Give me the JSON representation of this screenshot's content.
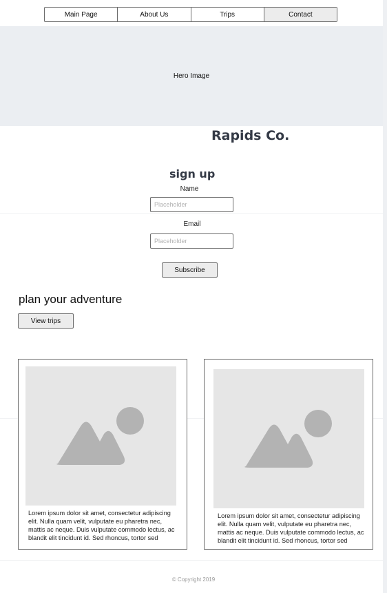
{
  "nav": {
    "items": [
      {
        "label": "Main Page"
      },
      {
        "label": "About Us"
      },
      {
        "label": "Trips"
      },
      {
        "label": "Contact"
      }
    ]
  },
  "hero": {
    "label": "Hero Image"
  },
  "brand": {
    "name": "Rapids Co."
  },
  "signup": {
    "title": "sign up",
    "name_label": "Name",
    "name_placeholder": "Placeholder",
    "email_label": "Email",
    "email_placeholder": "Placeholder",
    "subscribe_label": "Subscribe"
  },
  "plan": {
    "heading": "plan your adventure",
    "button_label": "View trips"
  },
  "cards": [
    {
      "image_icon": "image-placeholder-icon",
      "text": "Lorem ipsum dolor sit amet, consectetur adipiscing elit. Nulla quam velit, vulputate eu pharetra nec, mattis ac neque. Duis vulputate commodo lectus, ac blandit elit tincidunt id. Sed rhoncus, tortor sed"
    },
    {
      "image_icon": "image-placeholder-icon",
      "text": "Lorem ipsum dolor sit amet, consectetur adipiscing elit. Nulla quam velit, vulputate eu pharetra nec, mattis ac neque. Duis vulputate commodo lectus, ac blandit elit tincidunt id. Sed rhoncus, tortor sed"
    }
  ],
  "footer": {
    "copyright": "© Copyright 2019"
  },
  "colors": {
    "hero_bg": "#ebeef2",
    "brand_text": "#343a46",
    "button_bg": "#ececec",
    "placeholder_img": "#e6e6e6",
    "placeholder_shape": "#b3b3b3"
  }
}
